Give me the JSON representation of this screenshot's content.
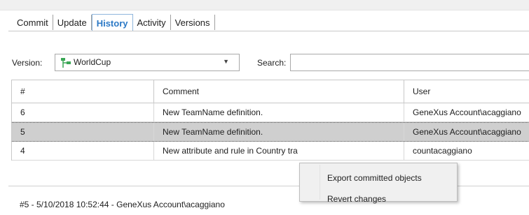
{
  "tabs": [
    {
      "label": "Commit",
      "active": false
    },
    {
      "label": "Update",
      "active": false
    },
    {
      "label": "History",
      "active": true
    },
    {
      "label": "Activity",
      "active": false
    },
    {
      "label": "Versions",
      "active": false
    }
  ],
  "toolbar": {
    "version_label": "Version:",
    "version_value": "WorldCup",
    "version_icon": "version-branch-icon",
    "search_label": "Search:",
    "search_value": ""
  },
  "table": {
    "columns": [
      "#",
      "Comment",
      "User"
    ],
    "rows": [
      {
        "number": "6",
        "comment": "New TeamName definition.",
        "user": "GeneXus Account\\acaggiano",
        "selected": false
      },
      {
        "number": "5",
        "comment": "New TeamName definition.",
        "user": "GeneXus Account\\acaggiano",
        "selected": true
      },
      {
        "number": "4",
        "comment": "New attribute and rule in Country tra",
        "user": "countacaggiano",
        "selected": false
      }
    ]
  },
  "context_menu": {
    "items": [
      "Export committed objects",
      "Revert changes"
    ]
  },
  "footer": {
    "text": "#5 - 5/10/2018 10:52:44 - GeneXus Account\\acaggiano"
  },
  "colors": {
    "active_tab": "#2b79c6",
    "selected_row": "#cfcfcf",
    "branch_icon_green": "#3aa655"
  }
}
